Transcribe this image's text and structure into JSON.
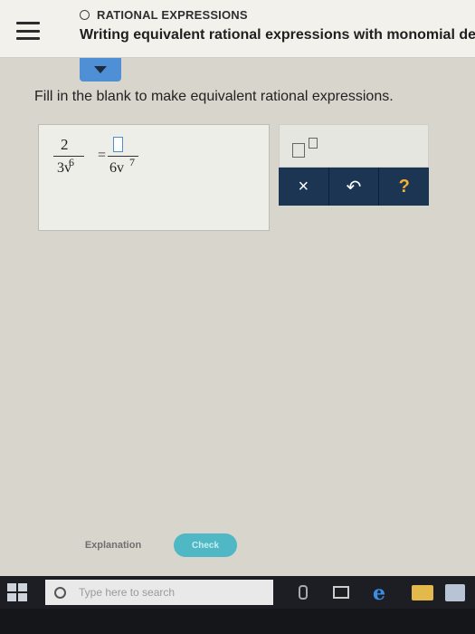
{
  "header": {
    "topic": "RATIONAL EXPRESSIONS",
    "title": "Writing equivalent rational expressions with monomial de"
  },
  "instruction": "Fill in the blank to make equivalent rational expressions.",
  "equation": {
    "left_numerator": "2",
    "left_exponent": "6",
    "left_denominator": "3v",
    "equals": "=",
    "right_exponent": "7",
    "right_denominator": "6v"
  },
  "keypad": {
    "clear_symbol": "×",
    "undo_symbol": "↶",
    "help_symbol": "?"
  },
  "buttons": {
    "explanation": "Explanation",
    "check": "Check"
  },
  "taskbar": {
    "search_placeholder": "Type here to search"
  },
  "colors": {
    "accent_blue": "#4e8fd6",
    "keypad_dark": "#1b3553",
    "check_teal": "#4fb8c4",
    "help_orange": "#f3b233"
  },
  "icons": [
    "hamburger-menu-icon",
    "circle-icon",
    "caret-down-icon",
    "exponent-template-icon",
    "close-icon",
    "undo-icon",
    "help-icon",
    "windows-start-icon",
    "search-circle-icon",
    "microphone-icon",
    "task-view-icon",
    "edge-browser-icon",
    "file-explorer-icon",
    "store-icon"
  ]
}
